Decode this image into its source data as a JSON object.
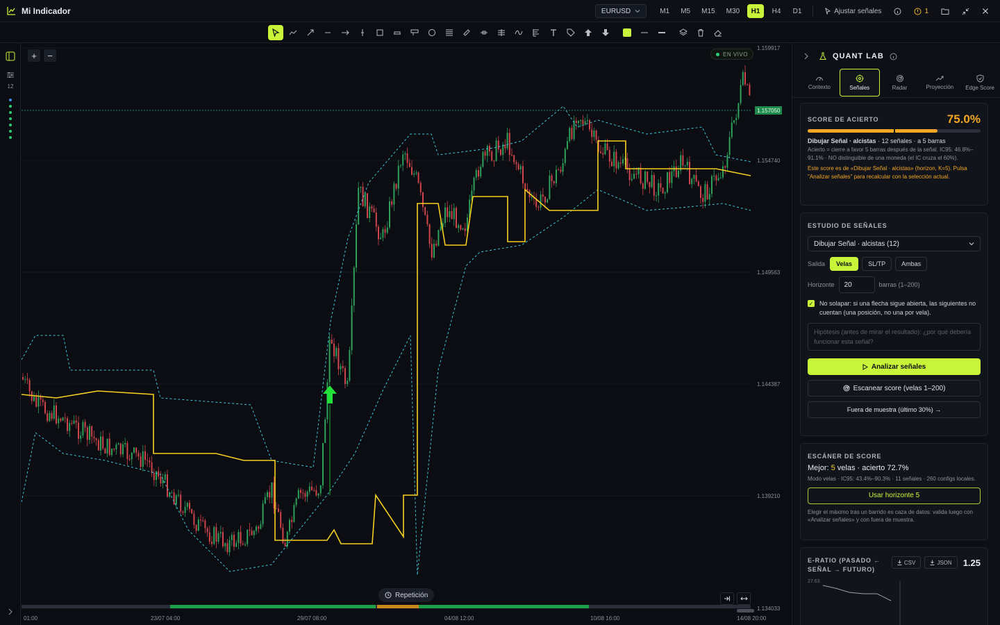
{
  "app": {
    "title": "Mi Indicador"
  },
  "topbar": {
    "symbol": "EURUSD",
    "timeframes": [
      "M1",
      "M5",
      "M15",
      "M30",
      "H1",
      "H4",
      "D1"
    ],
    "active_timeframe": "H1",
    "adjust_signals": "Ajustar señales",
    "alert_count": "1"
  },
  "leftbar": {
    "count": "12"
  },
  "chart": {
    "live": "EN VIVO",
    "replay": "Repetición",
    "current_price": "1.157050",
    "price_labels": [
      "1.159917",
      "1.154740",
      "1.149563",
      "1.144387",
      "1.139210",
      "1.134033"
    ],
    "time_labels": [
      "01:00",
      "23/07 04:00",
      "29/07 08:00",
      "04/08 12:00",
      "10/08 16:00",
      "14/08 20:00"
    ],
    "colors": {
      "bull": "#2ea05a",
      "bear": "#d0454c",
      "line": "#f5d020",
      "band": "#3fc6d8",
      "accent": "#c8f53a"
    }
  },
  "panel": {
    "title": "QUANT LAB",
    "tabs": [
      {
        "label": "Contexto",
        "icon": "gauge-icon"
      },
      {
        "label": "Señales",
        "icon": "target-icon"
      },
      {
        "label": "Radar",
        "icon": "radar-icon"
      },
      {
        "label": "Proyección",
        "icon": "trend-icon"
      },
      {
        "label": "Edge Score",
        "icon": "shield-icon"
      }
    ],
    "active_tab": "Señales",
    "score": {
      "title": "SCORE DE ACIERTO",
      "value": "75.0%",
      "fill_percent": 75,
      "line_name": "Dibujar Señal · alcistas",
      "line_rest": " · 12 señales · a 5 barras",
      "desc": "Acierto = cierre a favor 5 barras después de la señal. IC95: 46.8%–91.1% · NO distinguible de una moneda (el IC cruza el 60%).",
      "note": "Este score es de «Dibujar Señal · alcistas» (horizon, K=5). Pulsa \"Analizar señales\" para recalcular con la selección actual."
    },
    "study": {
      "title": "ESTUDIO DE SEÑALES",
      "select_value": "Dibujar Señal · alcistas (12)",
      "output_label": "Salida",
      "output_options": [
        "Velas",
        "SL/TP",
        "Ambas"
      ],
      "output_active": "Velas",
      "horizon_label": "Horizonte",
      "horizon_value": "20",
      "horizon_unit": "barras (1–200)",
      "no_overlap": "No solapar: si una flecha sigue abierta, las siguientes no cuentan (una posición, no una por vela).",
      "hypothesis_placeholder": "Hipótesis (antes de mirar el resultado): ¿por qué debería funcionar esta señal?",
      "analyze": "Analizar señales",
      "scan": "Escanear score (velas 1–200)",
      "oos": "Fuera de muestra (último 30%) →"
    },
    "scanner": {
      "title": "ESCÁNER DE SCORE",
      "best_prefix": "Mejor: ",
      "best_value": "5",
      "best_suffix": " velas · acierto 72.7%",
      "detail": "Modo velas · IC95: 43.4%–90.3% · 11 señales · 260 configs locales.",
      "use_button": "Usar horizonte 5",
      "warning": "Elegir el máximo tras un barrido es caza de datos: valida luego con «Analizar señales» y con fuera de muestra."
    },
    "eratio": {
      "title_line1": "E-RATIO (PASADO ←",
      "title_line2": "SEÑAL → FUTURO)",
      "csv": "CSV",
      "json": "JSON",
      "value": "1.25",
      "axis_top": "27.63"
    }
  }
}
